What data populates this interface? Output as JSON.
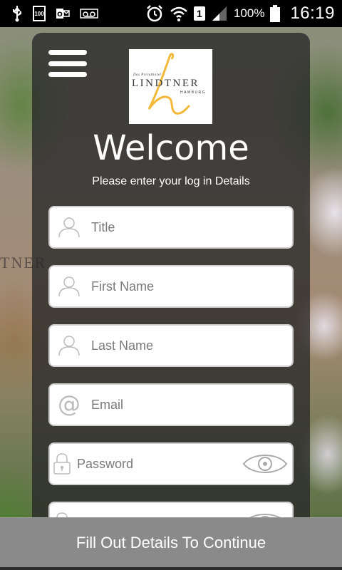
{
  "status_bar": {
    "battery_icon_text": "100",
    "sim_slot": "1",
    "battery_percent": "100%",
    "time": "16:19",
    "icons": [
      "usb-icon",
      "battery-100-icon",
      "outlook-icon",
      "voicemail-icon",
      "alarm-icon",
      "wifi-icon",
      "sim-icon",
      "signal-icon",
      "battery-icon"
    ]
  },
  "logo": {
    "small_text": "Das Privathotel",
    "name": "LINDTNER",
    "sub": "HAMBURG",
    "accent": "#f2b93b"
  },
  "header": {
    "title": "Welcome",
    "subtitle": "Please enter your log in Details"
  },
  "background": {
    "sign_text": "TNER"
  },
  "form": {
    "title_placeholder": "Title",
    "first_name_placeholder": "First Name",
    "last_name_placeholder": "Last Name",
    "email_placeholder": "Email",
    "password_placeholder": "Password",
    "confirm_password_placeholder": ""
  },
  "footer": {
    "continue_label": "Fill Out Details To Continue",
    "button_color": "#8a8a8a"
  }
}
